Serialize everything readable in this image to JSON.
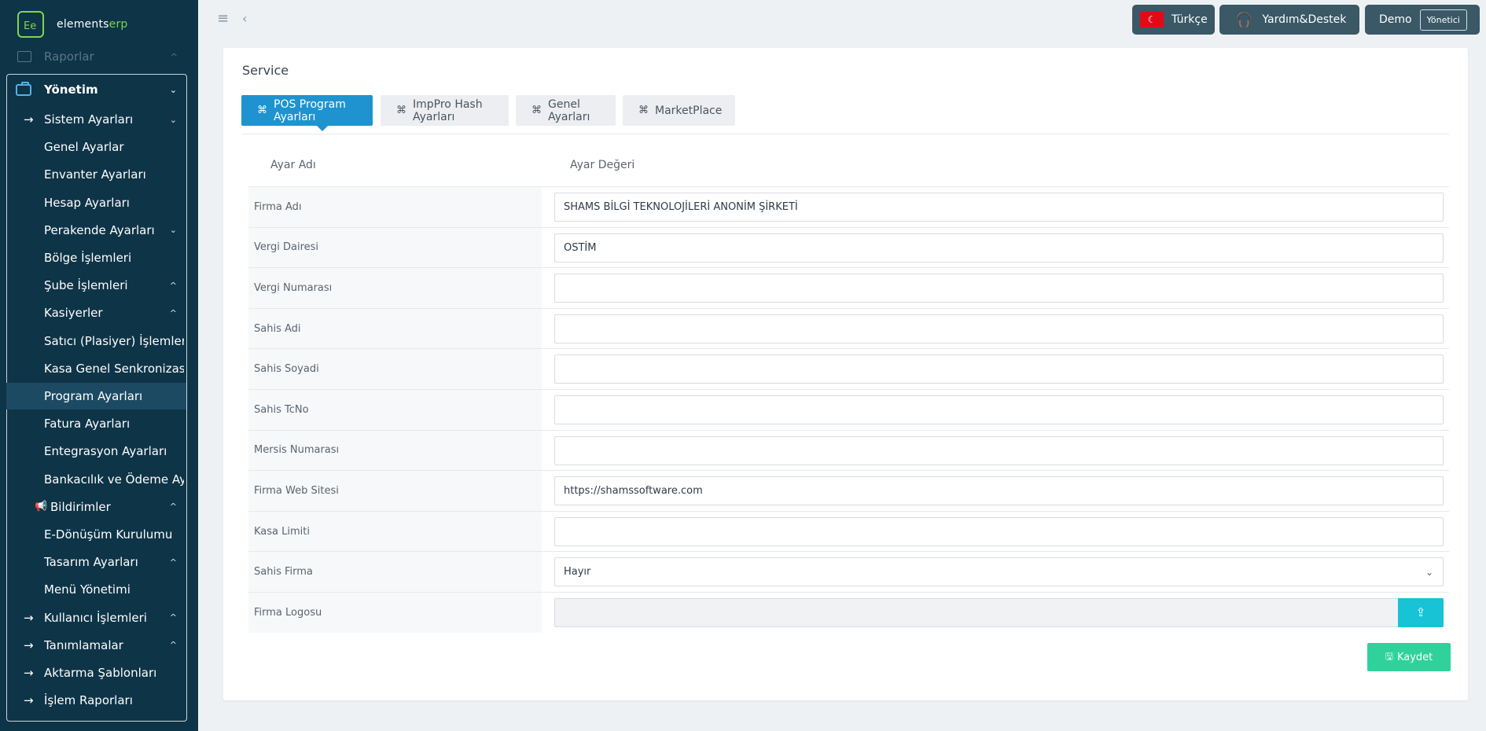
{
  "brand": {
    "logo": "Ee",
    "name_prefix": "elements",
    "name_suffix": "erp"
  },
  "sidebar": {
    "faded_item": "Raporlar",
    "section": "Yönetim",
    "items": [
      {
        "label": "Sistem Ayarları",
        "level": "sec",
        "arrow": true,
        "chevron": "⌄"
      },
      {
        "label": "Genel Ayarlar",
        "level": "sub"
      },
      {
        "label": "Envanter Ayarları",
        "level": "sub"
      },
      {
        "label": "Hesap Ayarları",
        "level": "sub"
      },
      {
        "label": "Perakende Ayarları",
        "level": "sub",
        "chevron": "⌄"
      },
      {
        "label": "Bölge İşlemleri",
        "level": "sub"
      },
      {
        "label": "Şube İşlemleri",
        "level": "sub",
        "chevron": "^"
      },
      {
        "label": "Kasiyerler",
        "level": "sub",
        "chevron": "^"
      },
      {
        "label": "Satıcı (Plasiyer) İşlemleri",
        "level": "sub"
      },
      {
        "label": "Kasa Genel Senkronizasyonu",
        "level": "sub"
      },
      {
        "label": "Program Ayarları",
        "level": "sub",
        "active": true
      },
      {
        "label": "Fatura Ayarları",
        "level": "sub"
      },
      {
        "label": "Entegrasyon Ayarları",
        "level": "sub"
      },
      {
        "label": "Bankacılık ve Ödeme Ayarları",
        "level": "sub"
      },
      {
        "label": "Bildirimler",
        "level": "sec",
        "bell": true,
        "chevron": "^"
      },
      {
        "label": "E-Dönüşüm Kurulumu",
        "level": "sub"
      },
      {
        "label": "Tasarım Ayarları",
        "level": "sub",
        "chevron": "^"
      },
      {
        "label": "Menü Yönetimi",
        "level": "sub"
      },
      {
        "label": "Kullanıcı İşlemleri",
        "level": "sec",
        "arrow": true,
        "chevron": "^"
      },
      {
        "label": "Tanımlamalar",
        "level": "sec",
        "arrow": true,
        "chevron": "^"
      },
      {
        "label": "Aktarma Şablonları",
        "level": "sec",
        "arrow": true
      },
      {
        "label": "İşlem Raporları",
        "level": "sec",
        "arrow": true
      }
    ]
  },
  "topbar": {
    "language": "Türkçe",
    "support": "Yardım&Destek",
    "user": "Demo",
    "role": "Yönetici"
  },
  "card": {
    "title": "Service",
    "tabs": [
      "POS Program Ayarları",
      "ImpPro Hash Ayarları",
      "Genel Ayarları",
      "MarketPlace"
    ],
    "col_name": "Ayar Adı",
    "col_value": "Ayar Değeri",
    "rows": [
      {
        "name": "Firma Adı",
        "value": "SHAMS BİLGİ TEKNOLOJİLERİ ANONİM ŞİRKETİ",
        "type": "text"
      },
      {
        "name": "Vergi Dairesi",
        "value": "OSTİM",
        "type": "text"
      },
      {
        "name": "Vergi Numarası",
        "value": "",
        "type": "text"
      },
      {
        "name": "Sahis Adi",
        "value": "",
        "type": "text"
      },
      {
        "name": "Sahis Soyadi",
        "value": "",
        "type": "text"
      },
      {
        "name": "Sahis TcNo",
        "value": "",
        "type": "text"
      },
      {
        "name": "Mersis Numarası",
        "value": "",
        "type": "text"
      },
      {
        "name": "Firma Web Sitesi",
        "value": "https://shamssoftware.com",
        "type": "text"
      },
      {
        "name": "Kasa Limiti",
        "value": "",
        "type": "text"
      },
      {
        "name": "Sahis Firma",
        "value": "Hayır",
        "type": "select"
      },
      {
        "name": "Firma Logosu",
        "value": "",
        "type": "file"
      }
    ],
    "save_label": "Kaydet"
  }
}
